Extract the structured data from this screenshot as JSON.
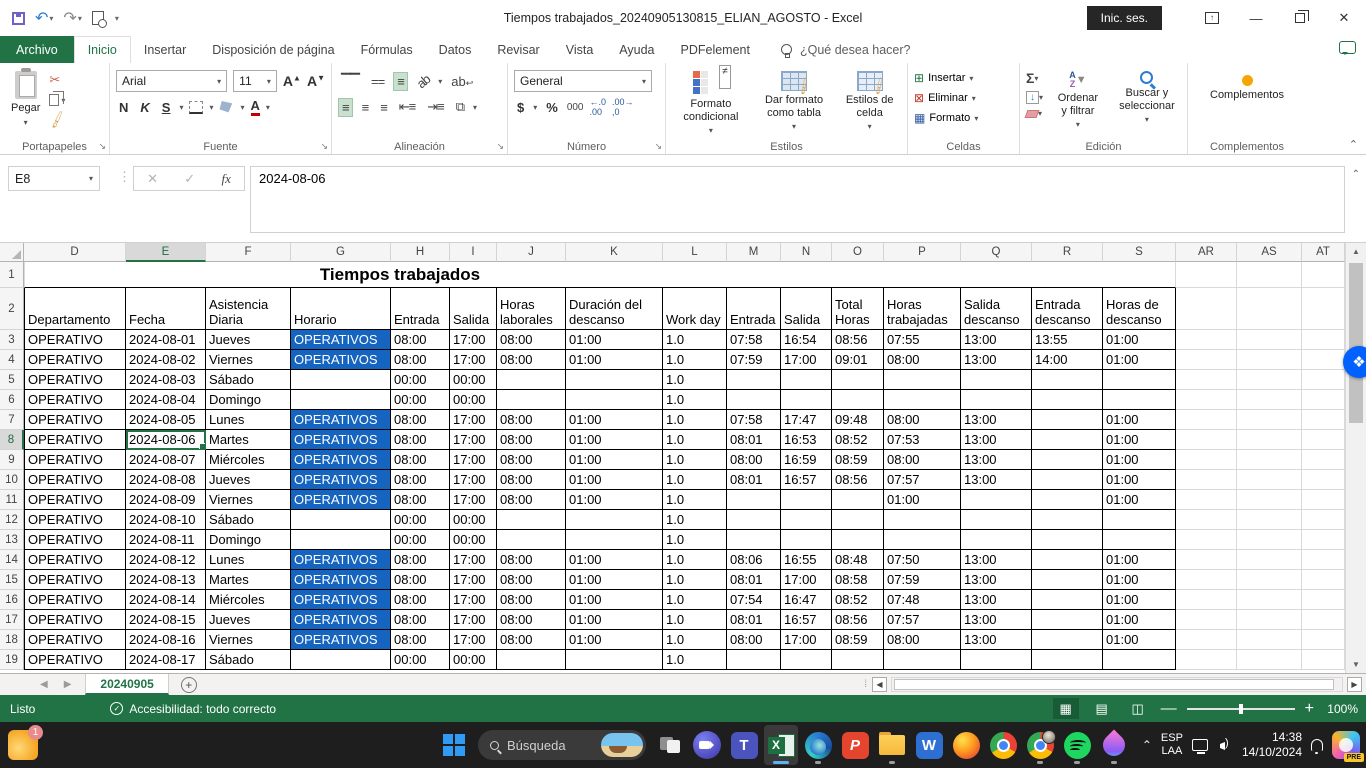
{
  "titlebar": {
    "title": "Tiempos trabajados_20240905130815_ELIAN_AGOSTO  -  Excel",
    "signin": "Inic. ses."
  },
  "tabs": {
    "archivo": "Archivo",
    "items": [
      "Inicio",
      "Insertar",
      "Disposición de página",
      "Fórmulas",
      "Datos",
      "Revisar",
      "Vista",
      "Ayuda",
      "PDFelement"
    ],
    "help_placeholder": "¿Qué desea hacer?"
  },
  "ribbon": {
    "clipboard": {
      "label": "Portapapeles",
      "paste": "Pegar"
    },
    "font": {
      "label": "Fuente",
      "family": "Arial",
      "size": "11",
      "bold": "N",
      "italic": "K",
      "underline": "S"
    },
    "alignment": {
      "label": "Alineación",
      "wrap": "ab"
    },
    "number": {
      "label": "Número",
      "format": "General",
      "currency": "$",
      "percent": "%",
      "thousands": "000"
    },
    "styles": {
      "label": "Estilos",
      "conditional": "Formato condicional",
      "astable": "Dar formato como tabla",
      "cellstyles": "Estilos de celda"
    },
    "cells": {
      "label": "Celdas",
      "insert": "Insertar",
      "delete": "Eliminar",
      "format": "Formato"
    },
    "editing": {
      "label": "Edición",
      "sum": "Σ",
      "sort": "Ordenar y filtrar",
      "find": "Buscar y seleccionar"
    },
    "addins": {
      "label": "Complementos",
      "button": "Complementos"
    }
  },
  "formula": {
    "name_box": "E8",
    "fx": "fx",
    "value": "2024-08-06"
  },
  "grid": {
    "row_header_width": 24,
    "columns": [
      [
        "D",
        102
      ],
      [
        "E",
        80
      ],
      [
        "F",
        85
      ],
      [
        "G",
        100
      ],
      [
        "H",
        59
      ],
      [
        "I",
        47
      ],
      [
        "J",
        69
      ],
      [
        "K",
        97
      ],
      [
        "L",
        64
      ],
      [
        "M",
        54
      ],
      [
        "N",
        51
      ],
      [
        "O",
        52
      ],
      [
        "P",
        77
      ],
      [
        "Q",
        71
      ],
      [
        "R",
        71
      ],
      [
        "S",
        73
      ]
    ],
    "extra_columns": [
      [
        "AR",
        61
      ],
      [
        "AS",
        65
      ],
      [
        "AT",
        43
      ]
    ],
    "title": "Tiempos trabajados",
    "headers": [
      "Departamento",
      "Fecha",
      "Asistencia Diaria",
      "Horario",
      "Entrada",
      "Salida",
      "Horas laborales",
      "Duración del descanso",
      "Work day",
      "Entrada",
      "Salida",
      "Total Horas",
      "Horas trabajadas",
      "Salida descanso",
      "Entrada descanso",
      "Horas de descanso"
    ],
    "highlight_value": "OPERATIVOS",
    "highlight_color": "#1565c0",
    "selected": {
      "col": "E",
      "row": 8
    },
    "rows": [
      {
        "n": 3,
        "c": [
          "OPERATIVO",
          "2024-08-01",
          "Jueves",
          "OPERATIVOS",
          "08:00",
          "17:00",
          "08:00",
          "01:00",
          "1.0",
          "07:58",
          "16:54",
          "08:56",
          "07:55",
          "13:00",
          "13:55",
          "01:00"
        ]
      },
      {
        "n": 4,
        "c": [
          "OPERATIVO",
          "2024-08-02",
          "Viernes",
          "OPERATIVOS",
          "08:00",
          "17:00",
          "08:00",
          "01:00",
          "1.0",
          "07:59",
          "17:00",
          "09:01",
          "08:00",
          "13:00",
          "14:00",
          "01:00"
        ]
      },
      {
        "n": 5,
        "c": [
          "OPERATIVO",
          "2024-08-03",
          "Sábado",
          "",
          "00:00",
          "00:00",
          "",
          "",
          "1.0",
          "",
          "",
          "",
          "",
          "",
          "",
          ""
        ]
      },
      {
        "n": 6,
        "c": [
          "OPERATIVO",
          "2024-08-04",
          "Domingo",
          "",
          "00:00",
          "00:00",
          "",
          "",
          "1.0",
          "",
          "",
          "",
          "",
          "",
          "",
          ""
        ]
      },
      {
        "n": 7,
        "c": [
          "OPERATIVO",
          "2024-08-05",
          "Lunes",
          "OPERATIVOS",
          "08:00",
          "17:00",
          "08:00",
          "01:00",
          "1.0",
          "07:58",
          "17:47",
          "09:48",
          "08:00",
          "13:00",
          "",
          "01:00"
        ]
      },
      {
        "n": 8,
        "c": [
          "OPERATIVO",
          "2024-08-06",
          "Martes",
          "OPERATIVOS",
          "08:00",
          "17:00",
          "08:00",
          "01:00",
          "1.0",
          "08:01",
          "16:53",
          "08:52",
          "07:53",
          "13:00",
          "",
          "01:00"
        ]
      },
      {
        "n": 9,
        "c": [
          "OPERATIVO",
          "2024-08-07",
          "Miércoles",
          "OPERATIVOS",
          "08:00",
          "17:00",
          "08:00",
          "01:00",
          "1.0",
          "08:00",
          "16:59",
          "08:59",
          "08:00",
          "13:00",
          "",
          "01:00"
        ]
      },
      {
        "n": 10,
        "c": [
          "OPERATIVO",
          "2024-08-08",
          "Jueves",
          "OPERATIVOS",
          "08:00",
          "17:00",
          "08:00",
          "01:00",
          "1.0",
          "08:01",
          "16:57",
          "08:56",
          "07:57",
          "13:00",
          "",
          "01:00"
        ]
      },
      {
        "n": 11,
        "c": [
          "OPERATIVO",
          "2024-08-09",
          "Viernes",
          "OPERATIVOS",
          "08:00",
          "17:00",
          "08:00",
          "01:00",
          "1.0",
          "",
          "",
          "",
          "01:00",
          "",
          "",
          "01:00"
        ]
      },
      {
        "n": 12,
        "c": [
          "OPERATIVO",
          "2024-08-10",
          "Sábado",
          "",
          "00:00",
          "00:00",
          "",
          "",
          "1.0",
          "",
          "",
          "",
          "",
          "",
          "",
          ""
        ]
      },
      {
        "n": 13,
        "c": [
          "OPERATIVO",
          "2024-08-11",
          "Domingo",
          "",
          "00:00",
          "00:00",
          "",
          "",
          "1.0",
          "",
          "",
          "",
          "",
          "",
          "",
          ""
        ]
      },
      {
        "n": 14,
        "c": [
          "OPERATIVO",
          "2024-08-12",
          "Lunes",
          "OPERATIVOS",
          "08:00",
          "17:00",
          "08:00",
          "01:00",
          "1.0",
          "08:06",
          "16:55",
          "08:48",
          "07:50",
          "13:00",
          "",
          "01:00"
        ]
      },
      {
        "n": 15,
        "c": [
          "OPERATIVO",
          "2024-08-13",
          "Martes",
          "OPERATIVOS",
          "08:00",
          "17:00",
          "08:00",
          "01:00",
          "1.0",
          "08:01",
          "17:00",
          "08:58",
          "07:59",
          "13:00",
          "",
          "01:00"
        ]
      },
      {
        "n": 16,
        "c": [
          "OPERATIVO",
          "2024-08-14",
          "Miércoles",
          "OPERATIVOS",
          "08:00",
          "17:00",
          "08:00",
          "01:00",
          "1.0",
          "07:54",
          "16:47",
          "08:52",
          "07:48",
          "13:00",
          "",
          "01:00"
        ]
      },
      {
        "n": 17,
        "c": [
          "OPERATIVO",
          "2024-08-15",
          "Jueves",
          "OPERATIVOS",
          "08:00",
          "17:00",
          "08:00",
          "01:00",
          "1.0",
          "08:01",
          "16:57",
          "08:56",
          "07:57",
          "13:00",
          "",
          "01:00"
        ]
      },
      {
        "n": 18,
        "c": [
          "OPERATIVO",
          "2024-08-16",
          "Viernes",
          "OPERATIVOS",
          "08:00",
          "17:00",
          "08:00",
          "01:00",
          "1.0",
          "08:00",
          "17:00",
          "08:59",
          "08:00",
          "13:00",
          "",
          "01:00"
        ]
      },
      {
        "n": 19,
        "c": [
          "OPERATIVO",
          "2024-08-17",
          "Sábado",
          "",
          "00:00",
          "00:00",
          "",
          "",
          "1.0",
          "",
          "",
          "",
          "",
          "",
          "",
          ""
        ]
      }
    ]
  },
  "sheet_bar": {
    "tab": "20240905"
  },
  "status": {
    "ready": "Listo",
    "accessibility": "Accesibilidad: todo correcto",
    "zoom_level": "100%"
  },
  "taskbar": {
    "widget_badge": "1",
    "search_placeholder": "Búsqueda",
    "lang_line1": "ESP",
    "lang_line2": "LAA",
    "time": "14:38",
    "date": "14/10/2024",
    "copilot_badge": "PRE"
  }
}
